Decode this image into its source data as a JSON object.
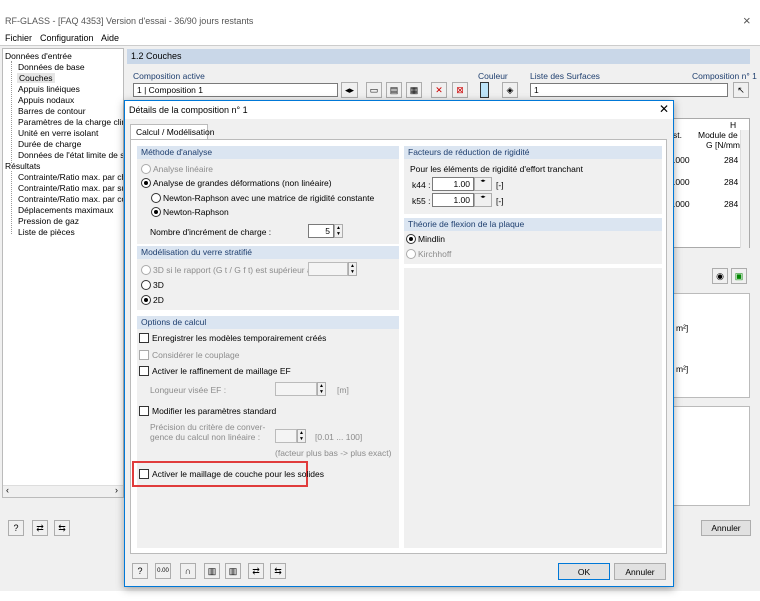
{
  "app": {
    "title": "RF-GLASS - [FAQ 4353] Version d'essai - 36/90 jours restants",
    "close": "×"
  },
  "menu": [
    "Fichier",
    "Configuration",
    "Aide"
  ],
  "tree": {
    "root1": "Données d'entrée",
    "items1": [
      "Données de base",
      "Couches",
      "Appuis linéiques",
      "Appuis nodaux",
      "Barres de contour",
      "Paramètres de la charge climatique",
      "Unité en verre isolant",
      "Durée de charge",
      "Données de l'état limite de service"
    ],
    "root2": "Résultats",
    "items2": [
      "Contrainte/Ratio max. par charge",
      "Contrainte/Ratio max. par surface",
      "Contrainte/Ratio max. par combinaison",
      "Déplacements maximaux",
      "Pression de gaz",
      "Liste de pièces"
    ]
  },
  "main": {
    "section": "1.2 Couches",
    "comp_label": "Composition active",
    "comp_value": "1 | Composition 1",
    "couleur": "Couleur",
    "surfaces_label": "Liste des Surfaces",
    "comp_n": "Composition n° 1",
    "surfaces_value": "1",
    "col_h": "H",
    "col_st": "st.",
    "col_mod": "Module de c",
    "col_g": "G [N/mm",
    "row_vals": [
      ".000",
      ".000",
      ".000"
    ],
    "row_g": [
      "284",
      "284",
      "284"
    ],
    "unit1": "m²]",
    "unit2": "m²]",
    "annuler": "Annuler"
  },
  "dialog": {
    "title": "Détails de la composition n° 1",
    "tab": "Calcul / Modélisation",
    "methode": {
      "title": "Méthode d'analyse",
      "lin": "Analyse linéaire",
      "nonlin": "Analyse de grandes déformations (non linéaire)",
      "nr_const": "Newton-Raphson avec une matrice de rigidité constante",
      "nr": "Newton-Raphson",
      "incr_label": "Nombre d'incrément de charge :",
      "incr_value": "5"
    },
    "verre": {
      "title": "Modélisation du verre stratifié",
      "opt3d_if": "3D si le rapport (G t / G f t) est supérieur à :",
      "opt3d": "3D",
      "opt2d": "2D"
    },
    "options": {
      "title": "Options de calcul",
      "save": "Enregistrer les modèles temporairement créés",
      "coupl": "Considérer le couplage",
      "raff": "Activer le raffinement de maillage EF",
      "long": "Longueur visée EF :",
      "long_unit": "[m]",
      "modif": "Modifier les paramètres standard",
      "prec1": "Précision du critère de conver-",
      "prec2": "gence du calcul non linéaire :",
      "prec_range": "[0.01 ... 100]",
      "prec_note": "(facteur plus bas -> plus exact)",
      "maillage": "Activer le maillage de couche pour les solides"
    },
    "facteurs": {
      "title": "Facteurs de réduction de rigidité",
      "sub": "Pour les éléments de rigidité d'effort tranchant",
      "k44": "k44 :",
      "k44v": "1.00",
      "k55": "k55 :",
      "k55v": "1.00",
      "unit": "[-]"
    },
    "theorie": {
      "title": "Théorie de flexion de la plaque",
      "mindlin": "Mindlin",
      "kirchhoff": "Kirchhoff"
    },
    "ok": "OK",
    "annuler": "Annuler"
  },
  "colors": {
    "accent": "#0078d7",
    "highlight": "#e03c3c",
    "header": "#dbe5f1"
  }
}
